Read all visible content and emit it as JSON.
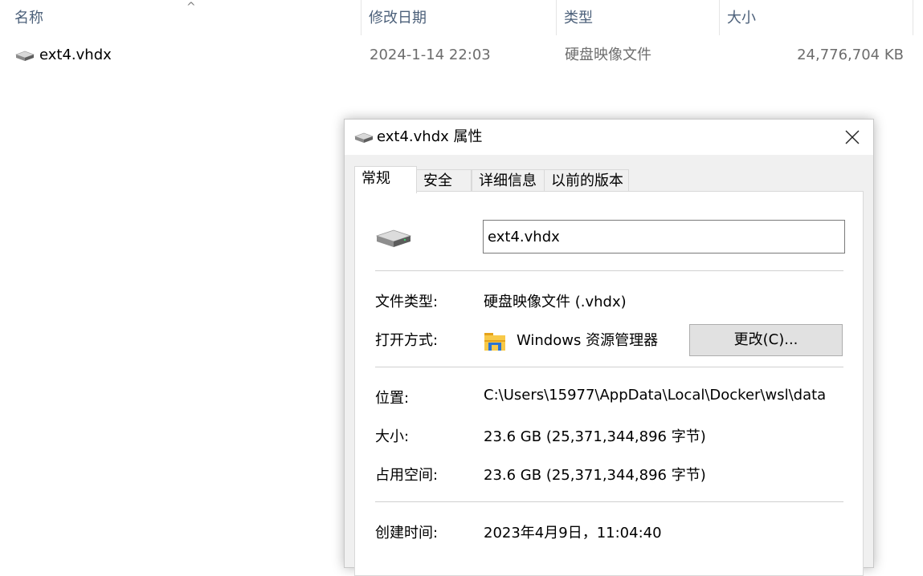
{
  "explorer": {
    "columns": [
      "名称",
      "修改日期",
      "类型",
      "大小"
    ],
    "file": {
      "name": "ext4.vhdx",
      "modified": "2024-1-14 22:03",
      "type": "硬盘映像文件",
      "size": "24,776,704 KB"
    }
  },
  "dialog": {
    "title": "ext4.vhdx 属性",
    "tabs": [
      "常规",
      "安全",
      "详细信息",
      "以前的版本"
    ],
    "active_tab": "常规",
    "filename": "ext4.vhdx",
    "file_type_label": "文件类型:",
    "file_type_value": "硬盘映像文件 (.vhdx)",
    "opens_with_label": "打开方式:",
    "opens_with_value": "Windows 资源管理器",
    "change_button": "更改(C)...",
    "location_label": "位置:",
    "location_value": "C:\\Users\\15977\\AppData\\Local\\Docker\\wsl\\data",
    "size_label": "大小:",
    "size_value": "23.6 GB (25,371,344,896 字节)",
    "size_on_disk_label": "占用空间:",
    "size_on_disk_value": "23.6 GB (25,371,344,896 字节)",
    "created_label": "创建时间:",
    "created_value": "2023年4月9日，11:04:40"
  },
  "icons": {
    "drive": "hard-drive-icon",
    "folder": "folder-icon",
    "close": "close-icon",
    "sort": "sort-ascending-icon"
  },
  "colors": {
    "header_text": "#4c607a",
    "dialog_bg": "#f0f0f0",
    "button_bg": "#e1e1e1"
  }
}
